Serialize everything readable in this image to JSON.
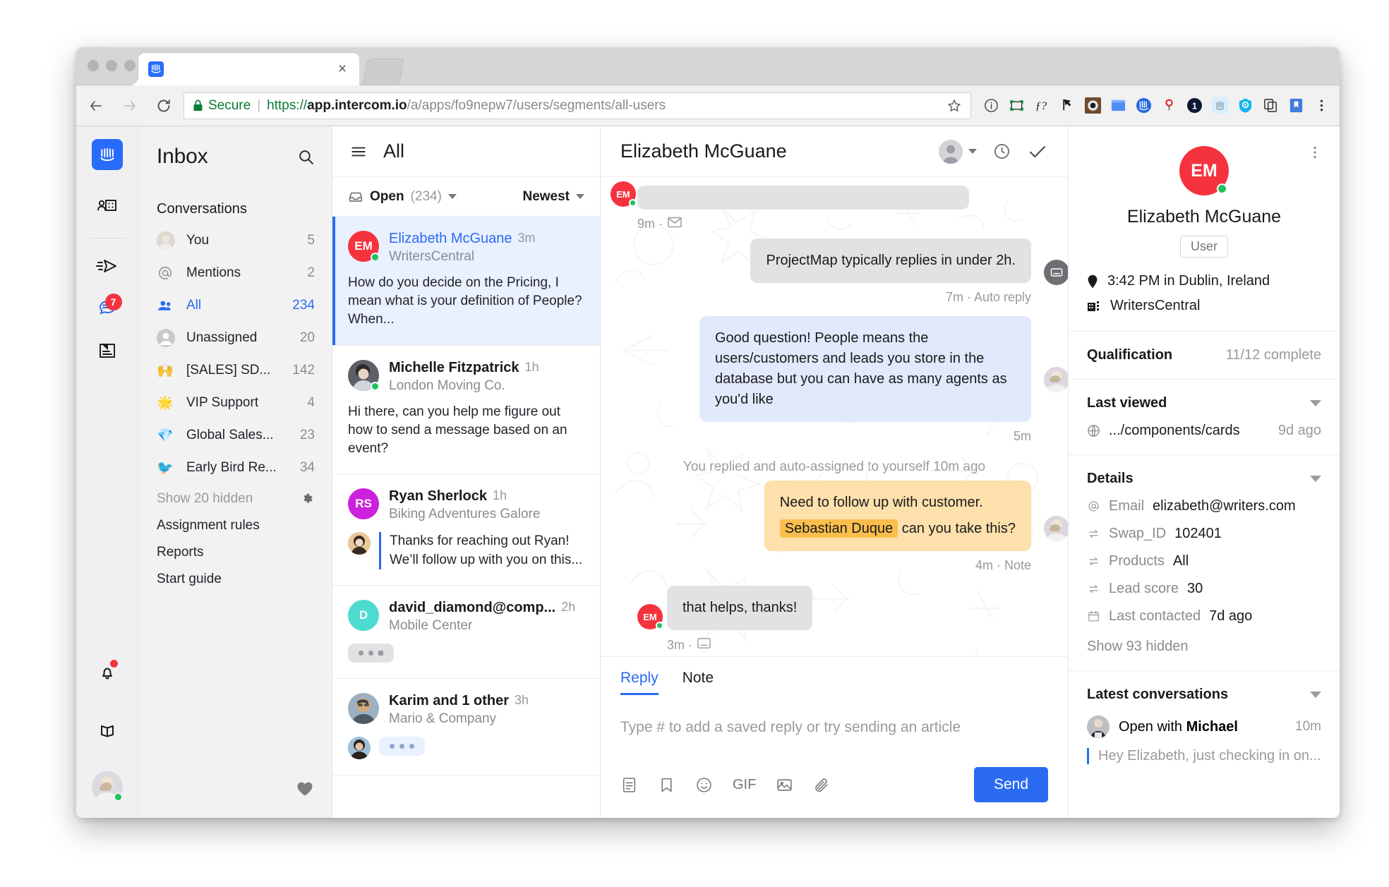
{
  "browser": {
    "tab_title": "",
    "favicon": "intercom-icon",
    "close_label": "×",
    "back_label": "back-arrow",
    "forward_label": "forward-arrow",
    "reload_label": "reload",
    "security_text": "Secure",
    "url_scheme": "https://",
    "url_host": "app.intercom.io",
    "url_path": "/a/apps/fo9nepw7/users/segments/all-users",
    "extensions": [
      "info-circle-icon",
      "crop-frame-icon",
      "f-question-icon",
      "pointer-flag-icon",
      "camera-lens-icon",
      "blue-notepad-icon",
      "intercom-circle-icon",
      "location-pin-icon",
      "badge-one-icon",
      "light-intercom-icon",
      "cyan-eye-icon",
      "copy-pages-icon",
      "bookmark-icon",
      "chrome-menu-icon"
    ]
  },
  "rail": {
    "logo": "intercom-logo",
    "items": [
      {
        "name": "contacts-icon",
        "badge": ""
      },
      {
        "name": "send-message-icon",
        "badge": ""
      },
      {
        "name": "conversations-icon",
        "badge": "7"
      },
      {
        "name": "articles-icon",
        "badge": ""
      }
    ],
    "bottom": [
      {
        "name": "bell-icon",
        "dot": true
      },
      {
        "name": "book-icon",
        "dot": false
      },
      {
        "name": "user-avatar",
        "dot": false
      }
    ]
  },
  "inbox": {
    "title": "Inbox",
    "search_icon": "search-icon",
    "section_label": "Conversations",
    "items": [
      {
        "icon": "avatar",
        "label": "You",
        "count": "5",
        "active": false
      },
      {
        "icon": "at-sign",
        "label": "Mentions",
        "count": "2",
        "active": false
      },
      {
        "icon": "people",
        "label": "All",
        "count": "234",
        "active": true
      },
      {
        "icon": "unassigned-avatar",
        "label": "Unassigned",
        "count": "20",
        "active": false
      },
      {
        "icon": "🙌",
        "label": "[SALES] SD...",
        "count": "142",
        "active": false
      },
      {
        "icon": "🌟",
        "label": "VIP Support",
        "count": "4",
        "active": false
      },
      {
        "icon": "💎",
        "label": "Global Sales...",
        "count": "23",
        "active": false
      },
      {
        "icon": "🐦",
        "label": "Early Bird Re...",
        "count": "34",
        "active": false
      }
    ],
    "show_hidden": "Show 20 hidden",
    "settings_icon": "gear-icon",
    "links": [
      "Assignment rules",
      "Reports",
      "Start guide"
    ],
    "heart_icon": "heart-icon"
  },
  "conversation_list": {
    "menu_icon": "hamburger-icon",
    "title": "All",
    "filter_icon": "inbox-icon",
    "filter_label": "Open",
    "filter_count": "(234)",
    "sort_label": "Newest",
    "items": [
      {
        "initials": "EM",
        "avatar_color": "#f5333f",
        "avatar_type": "initials",
        "name": "Elizabeth McGuane",
        "company": "WritersCentral",
        "time": "3m",
        "preview": "How do you decide on the Pricing, I mean what is your definition of People? When...",
        "selected": true,
        "online": true,
        "typing": "",
        "reply_preview": ""
      },
      {
        "initials": "",
        "avatar_color": "#9aa5ad",
        "avatar_type": "photo",
        "name": "Michelle Fitzpatrick",
        "company": "London Moving Co.",
        "time": "1h",
        "preview": "Hi there, can you help me figure out how to send a message based on an event?",
        "selected": false,
        "online": true,
        "typing": "",
        "reply_preview": ""
      },
      {
        "initials": "RS",
        "avatar_color": "#cc22dd",
        "avatar_type": "initials",
        "name": "Ryan Sherlock",
        "company": "Biking Adventures Galore",
        "time": "1h",
        "preview": "",
        "selected": false,
        "online": false,
        "typing": "",
        "reply_preview": "Thanks for reaching out Ryan! We’ll follow up with you on this..."
      },
      {
        "initials": "D",
        "avatar_color": "#4ddbd0",
        "avatar_type": "initials",
        "name": "david_diamond@comp...",
        "company": "Mobile Center",
        "time": "2h",
        "preview": "",
        "selected": false,
        "online": false,
        "typing": "grey",
        "reply_preview": ""
      },
      {
        "initials": "",
        "avatar_color": "#8fa3b5",
        "avatar_type": "photo",
        "name": "Karim and 1 other",
        "company": "Mario & Company",
        "time": "3h",
        "preview": "",
        "selected": false,
        "online": false,
        "typing": "blue",
        "reply_preview": ""
      }
    ]
  },
  "thread": {
    "title": "Elizabeth McGuane",
    "assignee_icon": "assignee-avatar",
    "assignee_caret": "chevron-down-icon",
    "snooze_icon": "clock-icon",
    "close_icon": "check-icon",
    "messages": [
      {
        "id": "m1",
        "side": "left",
        "style": "grey",
        "text": "",
        "meta": "9m · ",
        "meta_icon": "email-icon",
        "avatar": "EM",
        "redacted": true
      },
      {
        "id": "m2",
        "side": "right",
        "style": "grey",
        "text": "ProjectMap typically replies in under 2h.",
        "meta": "7m · Auto reply",
        "meta_icon": "",
        "avatar": "bot",
        "redacted": false
      },
      {
        "id": "m3",
        "side": "right",
        "style": "blue",
        "text": "Good question! People means the users/customers and leads you store in the database but you can have as many agents as you'd like",
        "meta": "5m",
        "meta_icon": "",
        "avatar": "agent",
        "redacted": false
      }
    ],
    "system_note": "You replied and auto-assigned to yourself 10m ago",
    "note": {
      "line1": "Need to follow up with customer.",
      "mention": "Sebastian Duque",
      "line2_rest": "can you take this?",
      "meta": "4m ·  Note"
    },
    "last_message": {
      "text": "that helps, thanks!",
      "meta": "3m · ",
      "meta_icon": "messenger-icon",
      "avatar": "EM"
    }
  },
  "composer": {
    "tabs": [
      {
        "label": "Reply",
        "active": true
      },
      {
        "label": "Note",
        "active": false
      }
    ],
    "placeholder": "Type # to add a saved reply or try sending an article",
    "tools": [
      "saved-reply-icon",
      "bookmark-icon",
      "emoji-icon",
      "GIF",
      "image-icon",
      "attachment-icon"
    ],
    "gif_label": "GIF",
    "send_label": "Send"
  },
  "right_panel": {
    "more_icon": "more-vertical-icon",
    "initials": "EM",
    "name": "Elizabeth McGuane",
    "role_tag": "User",
    "location_icon": "location-pin-icon",
    "location": "3:42 PM in Dublin, Ireland",
    "company_icon": "company-icon",
    "company": "WritersCentral",
    "qualification": {
      "label": "Qualification",
      "value": "11/12 complete"
    },
    "last_viewed": {
      "label": "Last viewed",
      "page_icon": "globe-icon",
      "page": ".../components/cards",
      "time": "9d ago"
    },
    "details": {
      "label": "Details",
      "rows": [
        {
          "icon": "at-sign-icon",
          "key": "Email",
          "value": "elizabeth@writers.com"
        },
        {
          "icon": "swap-icon",
          "key": "Swap_ID",
          "value": "102401"
        },
        {
          "icon": "swap-icon",
          "key": "Products",
          "value": "All"
        },
        {
          "icon": "swap-icon",
          "key": "Lead score",
          "value": "30"
        },
        {
          "icon": "calendar-icon",
          "key": "Last contacted",
          "value": "7d ago"
        }
      ],
      "show_hidden": "Show 93 hidden"
    },
    "latest_conversations": {
      "label": "Latest conversations",
      "items": [
        {
          "title_prefix": "Open with ",
          "title_name": "Michael",
          "time": "10m",
          "snippet": "Hey Elizabeth, just checking in on..."
        }
      ]
    }
  }
}
